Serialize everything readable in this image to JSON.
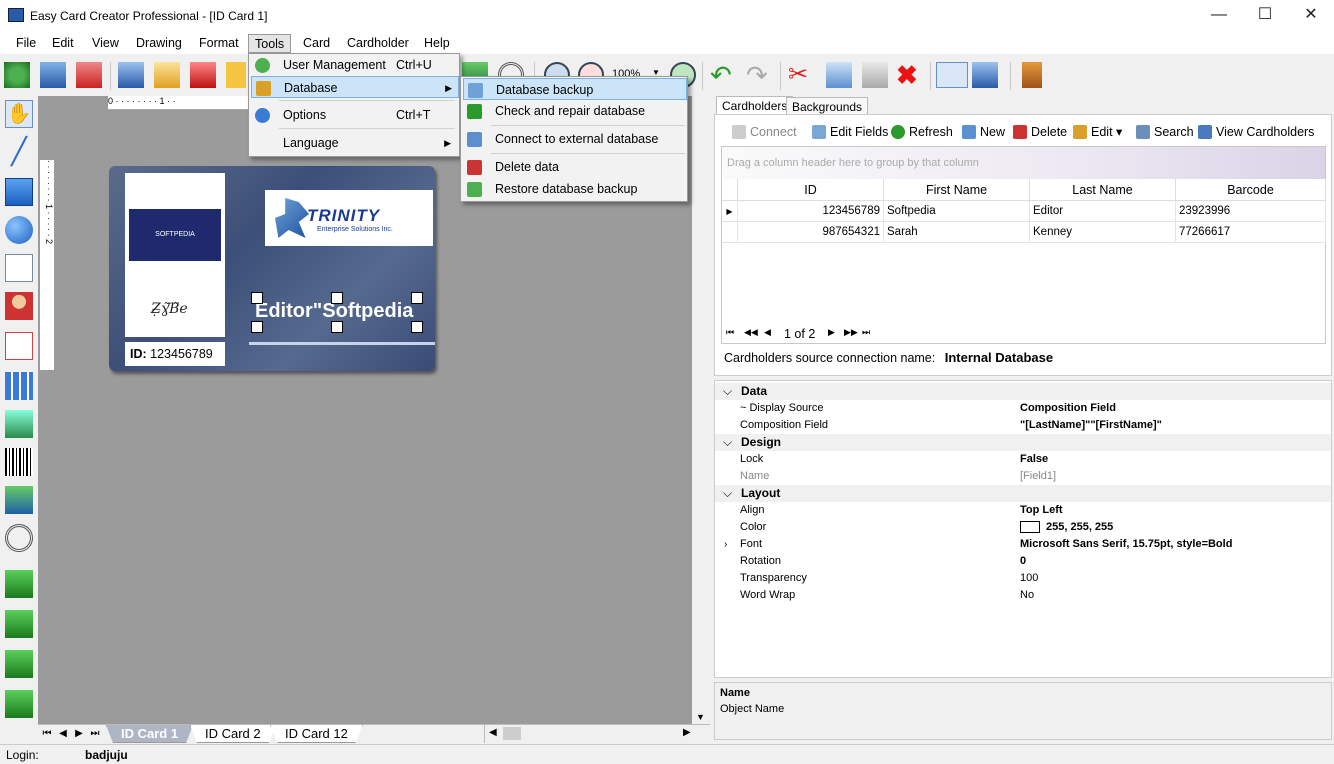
{
  "window": {
    "title": "Easy Card Creator Professional - [ID Card 1]"
  },
  "menubar": [
    "File",
    "Edit",
    "View",
    "Drawing",
    "Format",
    "Tools",
    "Card",
    "Cardholder",
    "Help"
  ],
  "tools_menu": [
    {
      "label": "User Management",
      "shortcut": "Ctrl+U"
    },
    {
      "label": "Database",
      "shortcut": ""
    },
    {
      "label": "Options",
      "shortcut": "Ctrl+T"
    },
    {
      "label": "Language",
      "shortcut": ""
    }
  ],
  "database_submenu": [
    "Database backup",
    "Check and repair database",
    "Connect to external database",
    "Delete data",
    "Restore database backup"
  ],
  "zoom": "100%",
  "ruler": {
    "top_marks": "0 · · · · · · · · 1 · ·",
    "left_marks": "· · · · · · · · 1 · · · · · 2"
  },
  "card": {
    "photo_logo": "SOFTPEDIA",
    "signature": "Ẓ̶ɣ̃Ɓ̃e",
    "company": "TRINITY",
    "company_sub": "Enterprise Solutions Inc.",
    "name_field": "Editor\"Softpedia",
    "id_label": "ID:",
    "id_value": "123456789"
  },
  "card_tabs": [
    "ID Card 1",
    "ID Card 2",
    "ID Card 12"
  ],
  "status": {
    "login_label": "Login:",
    "login_value": "badjuju"
  },
  "panel_tabs": [
    "Cardholders",
    "Backgrounds"
  ],
  "cardholder_toolbar": [
    "Connect",
    "Edit Fields",
    "Refresh",
    "New",
    "Delete",
    "Edit",
    "Search",
    "View Cardholders"
  ],
  "grid": {
    "group_hint": "Drag a column header here to group by that column",
    "columns": [
      "ID",
      "First Name",
      "Last Name",
      "Barcode"
    ],
    "rows": [
      [
        "123456789",
        "Softpedia",
        "Editor",
        "23923996"
      ],
      [
        "987654321",
        "Sarah",
        "Kenney",
        "77266617"
      ]
    ],
    "pager": "1 of 2"
  },
  "connection": {
    "label": "Cardholders source connection name:",
    "value": "Internal Database"
  },
  "properties": {
    "data_cat": "Data",
    "display_source_k": "~ Display Source",
    "display_source_v": "Composition Field",
    "composition_k": "Composition Field",
    "composition_v": "\"[LastName]\"\"[FirstName]\"",
    "design_cat": "Design",
    "lock_k": "Lock",
    "lock_v": "False",
    "name_k": "Name",
    "name_v": "[Field1]",
    "layout_cat": "Layout",
    "align_k": "Align",
    "align_v": "Top Left",
    "color_k": "Color",
    "color_v": "255, 255, 255",
    "font_k": "Font",
    "font_v": "Microsoft Sans Serif, 15.75pt, style=Bold",
    "rotation_k": "Rotation",
    "rotation_v": "0",
    "transparency_k": "Transparency",
    "transparency_v": "100",
    "wordwrap_k": "Word Wrap",
    "wordwrap_v": "No"
  },
  "description": {
    "title": "Name",
    "text": "Object Name"
  },
  "colors": {
    "highlight": "#cce4f7",
    "card": "#3c4f78"
  }
}
